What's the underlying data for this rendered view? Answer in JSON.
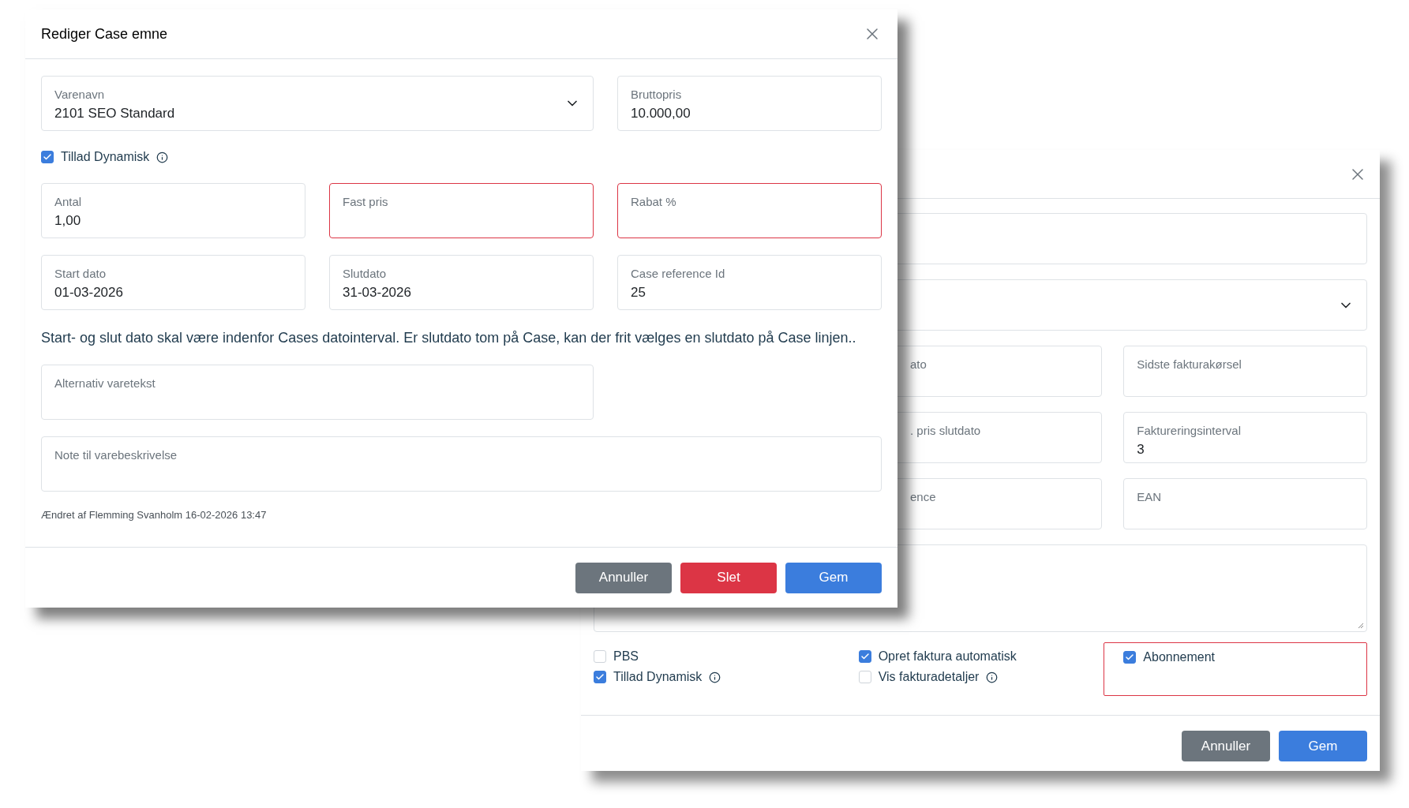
{
  "back_dialog": {
    "top_fields": [
      {
        "kind": "text",
        "invalid": false
      },
      {
        "kind": "select",
        "invalid": false
      }
    ],
    "grid_fields": [
      {
        "label": "ato",
        "invalid": false
      },
      {
        "label": "Sidste fakturakørsel",
        "invalid": false
      },
      {
        "label": ". pris slutdato",
        "invalid": false
      },
      {
        "label": "Faktureringsinterval",
        "value": "3",
        "invalid": false
      },
      {
        "label": "ence",
        "invalid": false
      },
      {
        "label": "EAN",
        "invalid": false
      }
    ],
    "checkbox_columns": [
      {
        "invalid": false,
        "items": [
          {
            "label": "PBS",
            "checked": false,
            "info": false
          },
          {
            "label": "Tillad Dynamisk",
            "checked": true,
            "info": true
          }
        ]
      },
      {
        "invalid": false,
        "items": [
          {
            "label": "Opret faktura automatisk",
            "checked": true,
            "info": false
          },
          {
            "label": "Vis fakturadetaljer",
            "checked": false,
            "info": true
          }
        ]
      },
      {
        "invalid": true,
        "items": [
          {
            "label": "Abonnement",
            "checked": true,
            "info": false
          }
        ]
      }
    ],
    "buttons": [
      {
        "label": "Annuller",
        "kind": "secondary"
      },
      {
        "label": "Gem",
        "kind": "primary"
      }
    ]
  },
  "front_dialog": {
    "title": "Rediger Case emne",
    "top_fields": [
      {
        "kind": "select",
        "label": "Varenavn",
        "value": "2101 SEO Standard",
        "invalid": false
      },
      {
        "kind": "text",
        "label": "Bruttopris",
        "value": "10.000,00",
        "invalid": false
      }
    ],
    "checkbox": {
      "label": "Tillad Dynamisk",
      "checked": true,
      "info": true
    },
    "grid_fields": [
      {
        "label": "Antal",
        "value": "1,00",
        "invalid": false
      },
      {
        "label": "Fast pris",
        "invalid": true
      },
      {
        "label": "Rabat %",
        "invalid": true
      },
      {
        "label": "Start dato",
        "value": "01-03-2026",
        "invalid": false
      },
      {
        "label": "Slutdato",
        "value": "31-03-2026",
        "invalid": false
      },
      {
        "label": "Case reference Id",
        "value": "25",
        "invalid": false
      }
    ],
    "info_text": "Start- og slut dato skal være indenfor Cases datointerval. Er slutdato tom på Case, kan der frit vælges en slutdato på Case linjen..",
    "alternative_field": {
      "label": "Alternativ varetekst",
      "invalid": false
    },
    "note_field": {
      "label": "Note til varebeskrivelse",
      "invalid": false
    },
    "changed_text": "Ændret af Flemming Svanholm 16-02-2026 13:47",
    "buttons": [
      {
        "label": "Annuller",
        "kind": "secondary"
      },
      {
        "label": "Slet",
        "kind": "danger"
      },
      {
        "label": "Gem",
        "kind": "primary"
      }
    ]
  }
}
